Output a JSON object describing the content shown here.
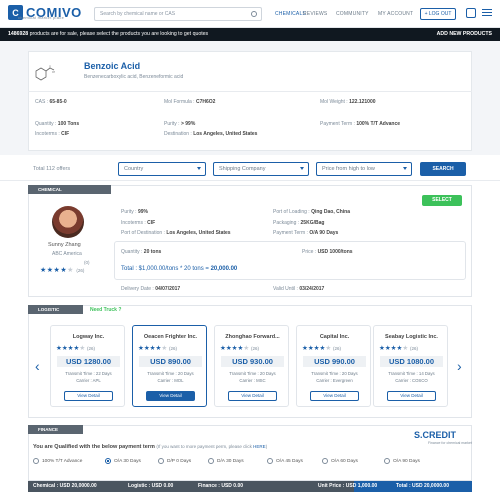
{
  "header": {
    "logo": "COMIVO",
    "logo_sub": "chemical market place",
    "search_placeholder": "Search by chemical name or CAS",
    "nav": [
      "CHEMICALS",
      "REVIEWS",
      "COMMUNITY",
      "MY ACCOUNT"
    ],
    "logout": "LOG OUT"
  },
  "banner": {
    "count": "1486928",
    "text": " products are for sale, please select the products you are looking to get quotes",
    "add": "ADD NEW PRODUCTS"
  },
  "product": {
    "name": "Benzoic Acid",
    "aliases": "Benzenecarboxylic acid, Benzeneformic acid",
    "cas_label": "CAS :",
    "cas": "65-85-0",
    "formula_label": "Mol Formula :",
    "formula": "C7H6O2",
    "weight_label": "Mol Weight :",
    "weight": "122.121000",
    "quantity_label": "Quantity :",
    "quantity": "100 Tons",
    "purity_label": "Purity :",
    "purity": "> 99%",
    "payment_label": "Payment Term :",
    "payment": "100% T/T Advance",
    "incoterms_label": "Incoterms :",
    "incoterms": "CIF",
    "destination_label": "Destination :",
    "destination": "Los Angeles, United States"
  },
  "filters": {
    "total": "Total 112 offers",
    "country": "Country",
    "shipping": "Shipping Company",
    "price": "Price from high to low",
    "search": "SEARCH"
  },
  "chemical": {
    "section": "CHEMICAL",
    "select": "SELECT",
    "seller_name": "Sunny Zhang",
    "seller_company": "ABC America",
    "seller_zero": "(0)",
    "seller_rating": 4,
    "seller_reviews": "(26)",
    "purity_label": "Purity :",
    "purity": "99%",
    "loading_label": "Port of Loading :",
    "loading": "Qing Dao, China",
    "incoterms_label": "Incoterms :",
    "incoterms": "CIF",
    "packaging_label": "Packaging :",
    "packaging": "25KG/Bag",
    "destport_label": "Port of Destination :",
    "destport": "Los Angeles, United States",
    "payterm_label": "Payment Term :",
    "payterm": "O/A 90 Days",
    "qty_label": "Quantity :",
    "qty": "20 tons",
    "price_label": "Price :",
    "price": "USD 1000/tons",
    "total_prefix": "Total : $1,000.00/tons * 20 tons = ",
    "total_value": "20,000.00",
    "delivery_label": "Delivery Date :",
    "delivery": "04/07/2017",
    "valid_label": "Valid Until :",
    "valid": "03/24/2017"
  },
  "logistic": {
    "section": "LOGISTIC",
    "need_truck": "Need Truck ?",
    "cards": [
      {
        "name": "Logway Inc.",
        "rating": 4,
        "reviews": "(26)",
        "price": "USD 1280.00",
        "transit": "Transmit Time : 22 Days",
        "carrier": "Carrier : APL",
        "button": "View Detail"
      },
      {
        "name": "Oeacen Frighter Inc.",
        "rating": 4,
        "reviews": "(26)",
        "price": "USD 890.00",
        "transit": "Transmit Time : 20 Days",
        "carrier": "Carrier : MOL",
        "button": "View Detail"
      },
      {
        "name": "Zhonghao Forward...",
        "rating": 4,
        "reviews": "(26)",
        "price": "USD 930.00",
        "transit": "Transmit Time : 20 Days",
        "carrier": "Carrier : MSC",
        "button": "View Detail"
      },
      {
        "name": "Capital Inc.",
        "rating": 4,
        "reviews": "(26)",
        "price": "USD 990.00",
        "transit": "Transmit Time : 20 Days",
        "carrier": "Carrier : Evergreen",
        "button": "View Detail"
      },
      {
        "name": "Seabay Logistic Inc.",
        "rating": 4,
        "reviews": "(26)",
        "price": "USD 1080.00",
        "transit": "Transmit Time : 14 Days",
        "carrier": "Carrier : COSCO",
        "button": "View Detail"
      }
    ]
  },
  "finance": {
    "section": "FINANCE",
    "qualified": "You are Qualified with the below payment term",
    "more": "(If you want to more payment perm, please click ",
    "here": "HERE",
    "close": ")",
    "brand": "S.CREDIT",
    "brand_sub": "Finance for chemical market",
    "options": [
      "100% T/T Advance",
      "O/A 30 Days",
      "D/P 0 Days",
      "D/A 30 Days",
      "O/A 45 Days",
      "O/A 60 Days",
      "O/A 90 Days"
    ],
    "selected": "O/A 30 Days"
  },
  "footer": {
    "chemical": "Chemical : USD 20,0000.00",
    "logistic": "Logistic : USD 0.00",
    "finance": "Finance : USD 0.00",
    "unit_price": "Unit Price : USD 1,000.00",
    "total": "Total : USD 20,0000.00"
  },
  "colors": {
    "brand": "#1b5fa8",
    "select": "#3cc15a",
    "banner": "#101820"
  }
}
